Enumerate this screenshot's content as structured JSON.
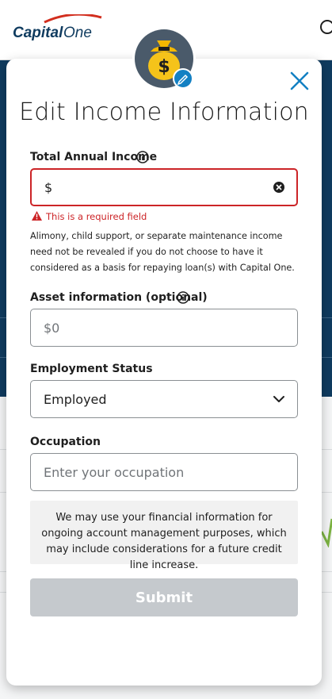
{
  "brand": {
    "logo_text": "Capital One",
    "accent": "#0f3b5f",
    "logo_red": "#d22e1e"
  },
  "modal": {
    "title": "Edit Income Information",
    "close_icon": "close-icon",
    "avatar_icon": "money-bag-icon",
    "avatar_edit_icon": "pencil-icon"
  },
  "form": {
    "income": {
      "label": "Total Annual Income",
      "value": "$",
      "error": "This is a required field",
      "help": "Alimony, child support, or separate maintenance income need not be revealed if you do not choose to have it considered as a basis for repaying loan(s) with Capital One."
    },
    "assets": {
      "label": "Asset information (optional)",
      "placeholder": "$0"
    },
    "employment": {
      "label": "Employment Status",
      "value": "Employed"
    },
    "occupation": {
      "label": "Occupation",
      "placeholder": "Enter your occupation"
    },
    "notice": "We may use your financial information for ongoing account management purposes, which may include considerations for a future credit line increase.",
    "submit_label": "Submit"
  },
  "colors": {
    "error": "#cc2427",
    "link_blue": "#1380c3",
    "disabled": "#c5c9cd"
  }
}
